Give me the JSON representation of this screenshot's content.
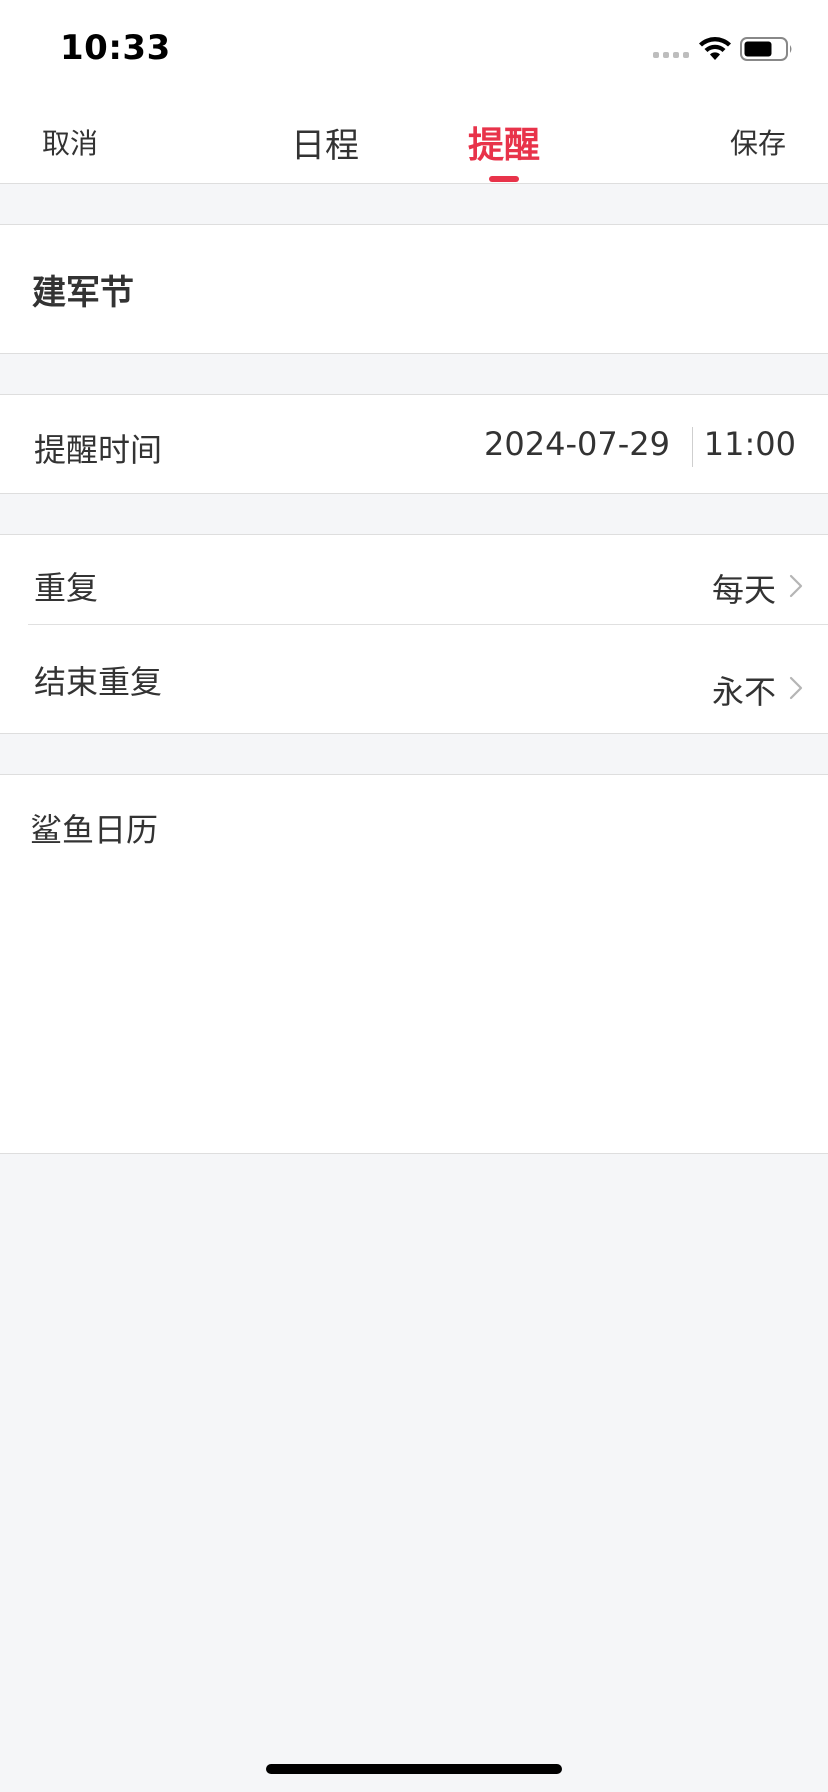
{
  "status_bar": {
    "time": "10:33"
  },
  "nav": {
    "cancel_label": "取消",
    "save_label": "保存",
    "tabs": [
      {
        "label": "日程",
        "active": false
      },
      {
        "label": "提醒",
        "active": true
      }
    ],
    "accent_color": "#e8334a"
  },
  "event": {
    "title": "建军节"
  },
  "reminder_time": {
    "label": "提醒时间",
    "date": "2024-07-29",
    "time": "11:00"
  },
  "repeat": {
    "label": "重复",
    "value": "每天"
  },
  "end_repeat": {
    "label": "结束重复",
    "value": "永不"
  },
  "calendar": {
    "name": "鲨鱼日历"
  }
}
